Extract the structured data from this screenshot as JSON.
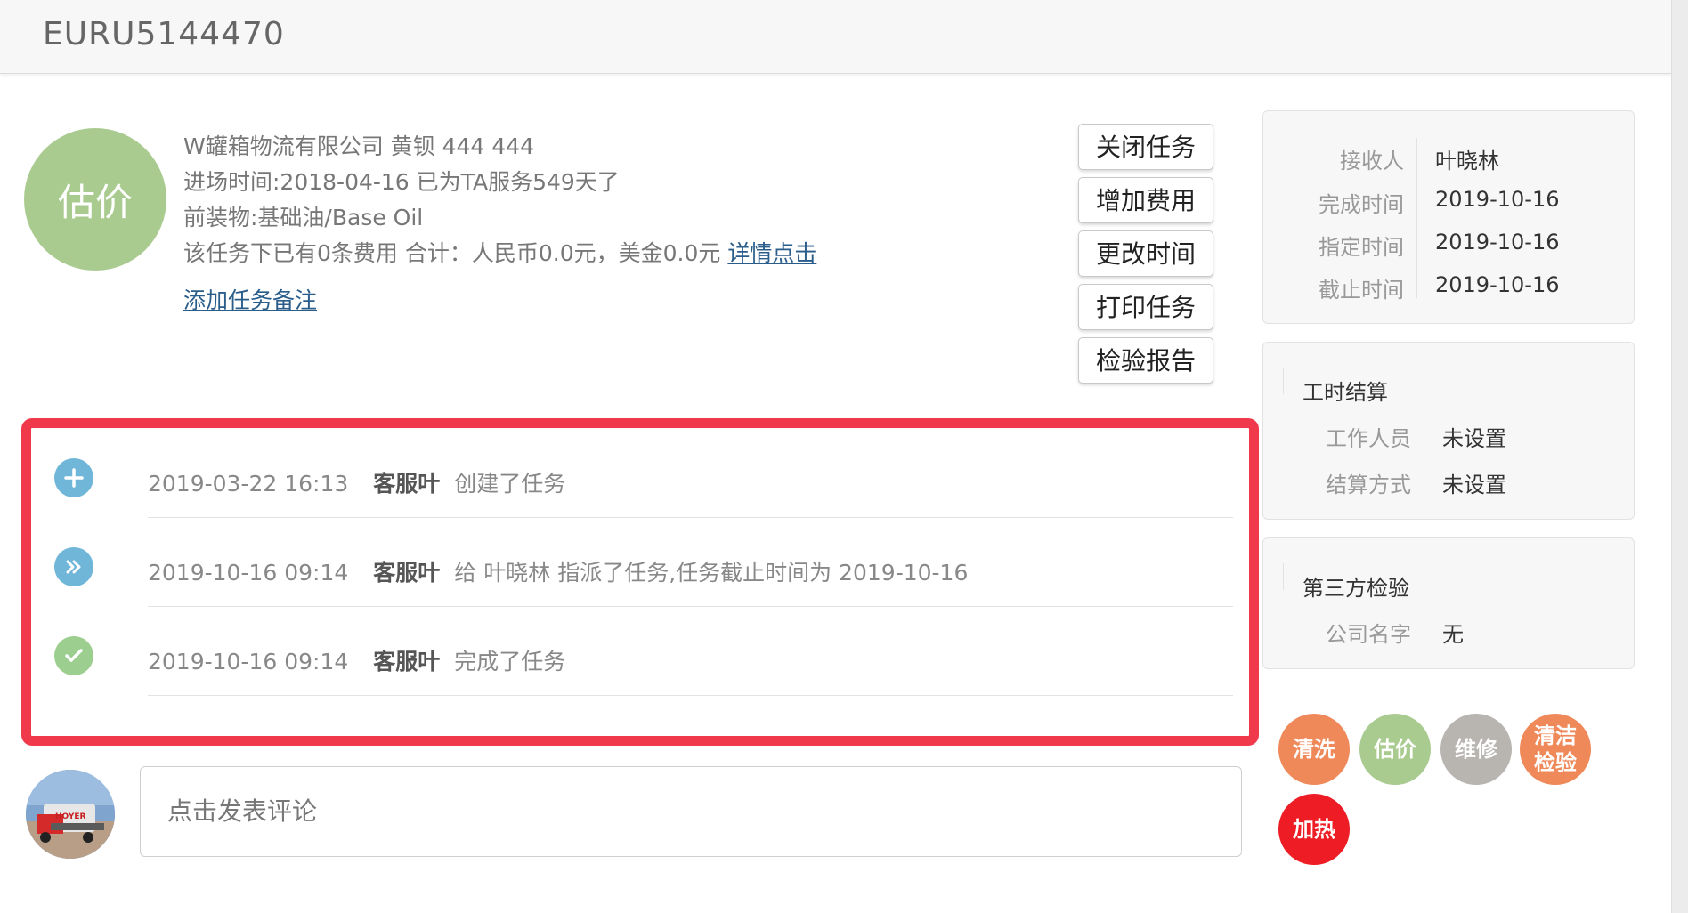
{
  "header": {
    "title": "EURU5144470"
  },
  "task": {
    "status_label": "估价",
    "company_line": "W罐箱物流有限公司 黄钡 444 444",
    "entry_line": "进场时间:2018-04-16 已为TA服务549天了",
    "cargo_line": "前装物:基础油/Base Oil",
    "fee_line": "该任务下已有0条费用 合计：人民币0.0元，美金0.0元",
    "fee_detail_link": "详情点击",
    "add_note_link": "添加任务备注"
  },
  "actions": [
    {
      "label": "关闭任务"
    },
    {
      "label": "增加费用"
    },
    {
      "label": "更改时间"
    },
    {
      "label": "打印任务"
    },
    {
      "label": "检验报告"
    }
  ],
  "timeline": [
    {
      "icon": "plus-icon",
      "color": "#6fb6d9",
      "time": "2019-03-22 16:13",
      "who": "客服叶",
      "text": "创建了任务"
    },
    {
      "icon": "forward-icon",
      "color": "#6fb6d9",
      "time": "2019-10-16 09:14",
      "who": "客服叶",
      "text": "给 叶晓林 指派了任务,任务截止时间为 2019-10-16"
    },
    {
      "icon": "check-icon",
      "color": "#9ccf8f",
      "time": "2019-10-16 09:14",
      "who": "客服叶",
      "text": "完成了任务"
    }
  ],
  "comment": {
    "placeholder": "点击发表评论"
  },
  "assignment_panel": {
    "rows": [
      {
        "label": "接收人",
        "value": "叶晓林"
      },
      {
        "label": "完成时间",
        "value": "2019-10-16"
      },
      {
        "label": "指定时间",
        "value": "2019-10-16"
      },
      {
        "label": "截止时间",
        "value": "2019-10-16"
      }
    ]
  },
  "labor_panel": {
    "title": "工时结算",
    "rows": [
      {
        "label": "工作人员",
        "value": "未设置"
      },
      {
        "label": "结算方式",
        "value": "未设置"
      }
    ]
  },
  "inspection_panel": {
    "title": "第三方检验",
    "rows": [
      {
        "label": "公司名字",
        "value": "无"
      }
    ]
  },
  "tags": [
    {
      "label": "清洗",
      "color": "#f0895a"
    },
    {
      "label": "估价",
      "color": "#a9cb8f"
    },
    {
      "label": "维修",
      "color": "#b8b5b1"
    },
    {
      "label": "清洁\n检验",
      "color": "#f0895a"
    },
    {
      "label": "加热",
      "color": "#ee1c24"
    }
  ],
  "avatar_sign_text": "HOYER"
}
